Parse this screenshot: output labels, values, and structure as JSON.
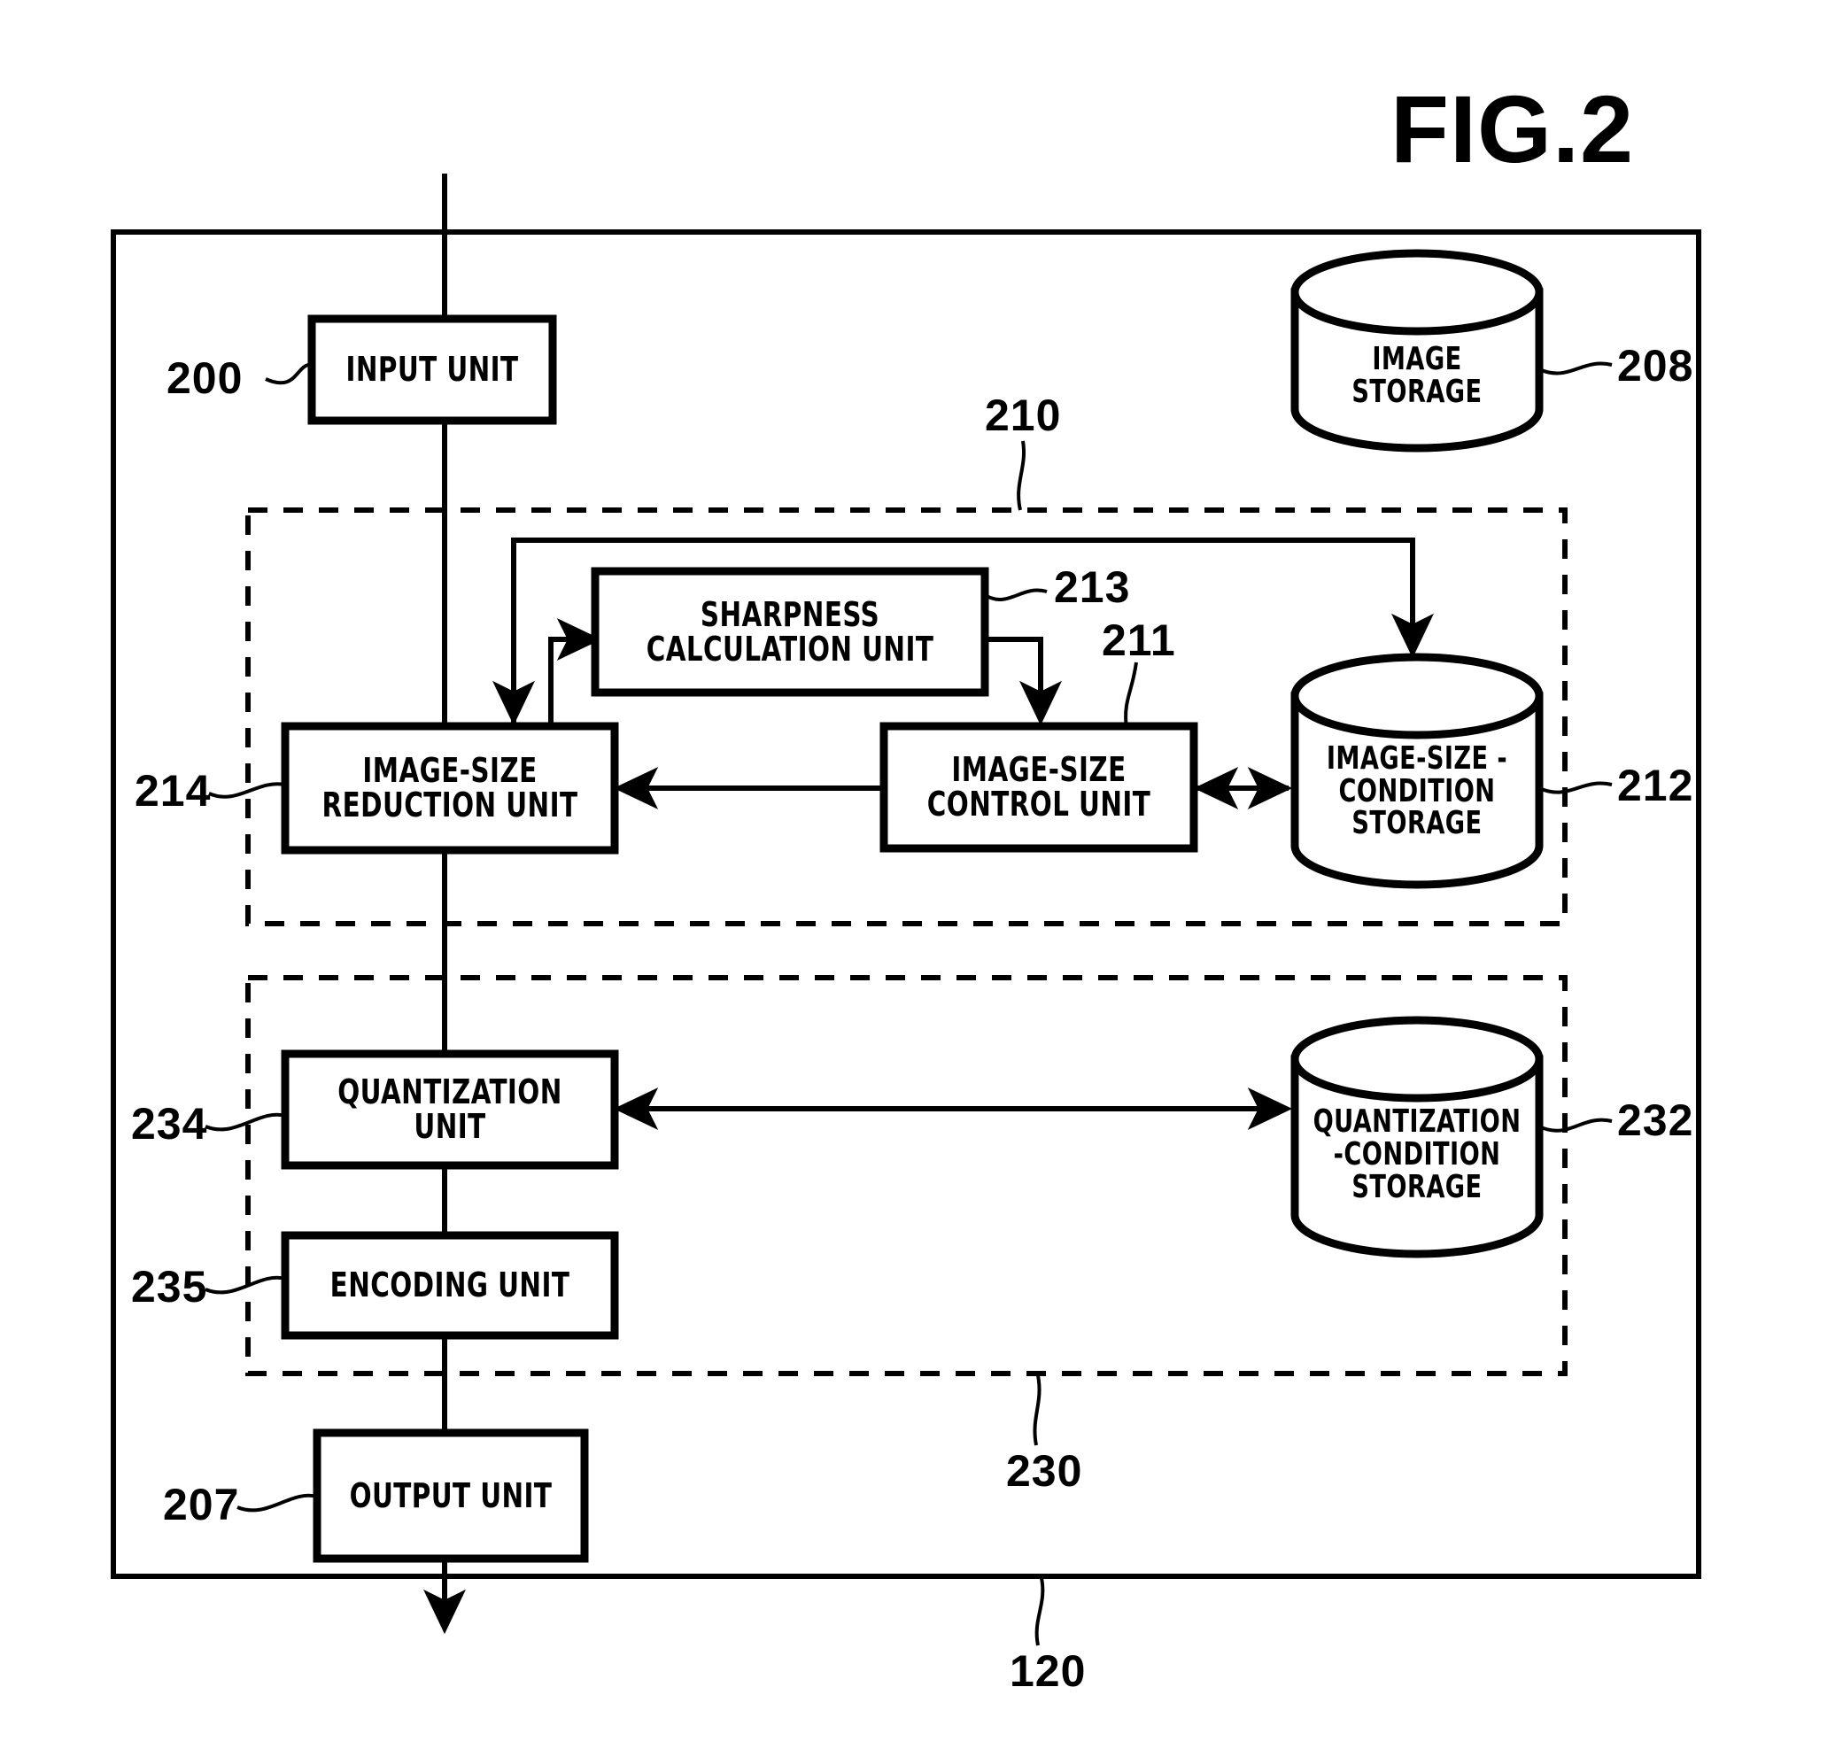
{
  "figure": {
    "title": "FIG.2",
    "system_ref": "120"
  },
  "blocks": [
    {
      "id": "input-unit",
      "ref": "200",
      "lines": [
        "INPUT UNIT"
      ]
    },
    {
      "id": "sharpness-calc-unit",
      "ref": "213",
      "lines": [
        "SHARPNESS",
        "CALCULATION UNIT"
      ]
    },
    {
      "id": "image-size-reduction",
      "ref": "214",
      "lines": [
        "IMAGE-SIZE",
        "REDUCTION UNIT"
      ]
    },
    {
      "id": "image-size-control",
      "ref": "211",
      "lines": [
        "IMAGE-SIZE",
        "CONTROL UNIT"
      ]
    },
    {
      "id": "quantization-unit",
      "ref": "234",
      "lines": [
        "QUANTIZATION",
        "UNIT"
      ]
    },
    {
      "id": "encoding-unit",
      "ref": "235",
      "lines": [
        "ENCODING UNIT"
      ]
    },
    {
      "id": "output-unit",
      "ref": "207",
      "lines": [
        "OUTPUT UNIT"
      ]
    }
  ],
  "storages": [
    {
      "id": "image-storage",
      "ref": "208",
      "lines": [
        "IMAGE",
        "STORAGE"
      ]
    },
    {
      "id": "image-size-cond-storage",
      "ref": "212",
      "lines": [
        "IMAGE-SIZE",
        "-CONDITION",
        "STORAGE"
      ]
    },
    {
      "id": "quantization-cond-storage",
      "ref": "232",
      "lines": [
        "QUANTIZATION",
        "-CONDITION",
        "STORAGE"
      ]
    }
  ],
  "groups": [
    {
      "id": "image-size-processing-group",
      "ref": "210"
    },
    {
      "id": "encoding-processing-group",
      "ref": "230"
    }
  ],
  "colors": {
    "stroke": "#000000",
    "background": "#ffffff"
  }
}
